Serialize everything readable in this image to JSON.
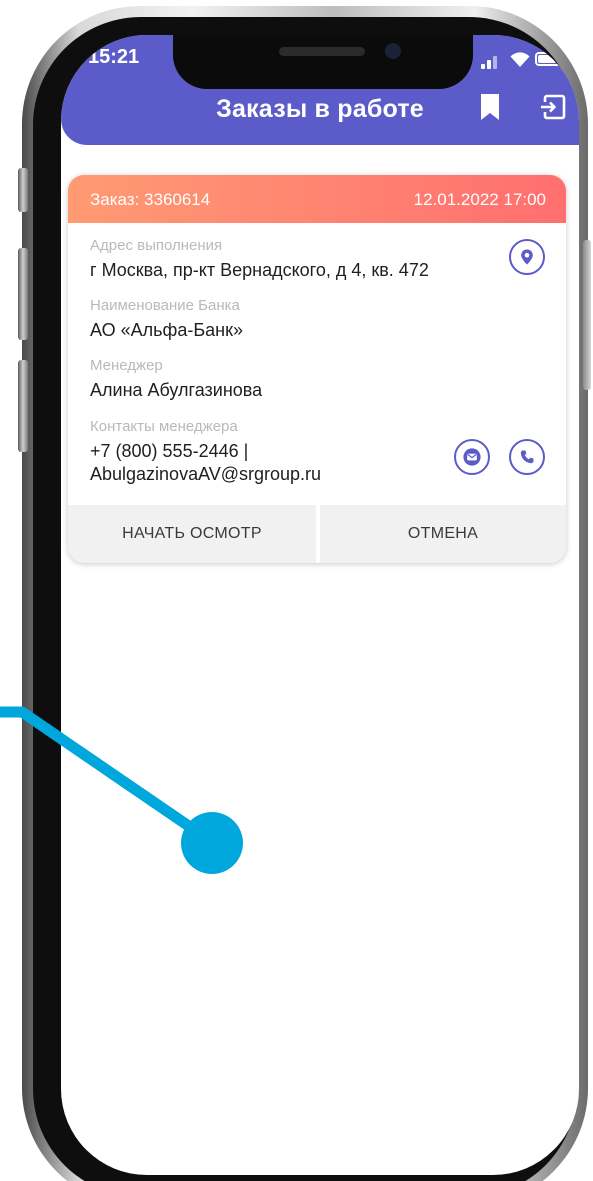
{
  "status_bar": {
    "time": "15:21"
  },
  "app_bar": {
    "title": "Заказы в работе",
    "icons": [
      "bookmark-icon",
      "logout-icon"
    ],
    "color": "#5b5cc9"
  },
  "order": {
    "number_label": "Заказ: 3360614",
    "datetime": "12.01.2022 17:00",
    "fields": [
      {
        "label": "Адрес выполнения",
        "value": "г Москва, пр-кт Вернадского, д 4, кв. 472"
      },
      {
        "label": "Наименование Банка",
        "value": "АО «Альфа-Банк»"
      },
      {
        "label": "Менеджер",
        "value": "Алина Абулгазинова"
      },
      {
        "label": "Контакты менеджера",
        "value_line1": "+7 (800) 555-2446 |",
        "value_line2": "AbulgazinovaAV@srgroup.ru"
      }
    ],
    "actions": {
      "start": "НАЧАТЬ ОСМОТР",
      "cancel": "ОТМЕНА"
    },
    "icons": [
      "location-pin-icon",
      "mail-icon",
      "phone-icon"
    ],
    "header_gradient": [
      "#ff9a73",
      "#ff6f6f"
    ]
  },
  "colors": {
    "accent": "#5b5cc9",
    "pointer": "#00a7dc"
  }
}
